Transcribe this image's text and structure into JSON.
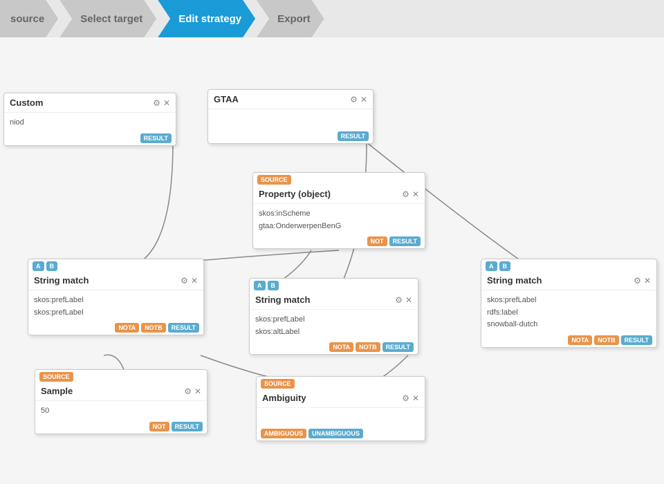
{
  "nav": {
    "steps": [
      {
        "id": "source",
        "label": "source",
        "state": "inactive"
      },
      {
        "id": "select-target",
        "label": "Select target",
        "state": "inactive"
      },
      {
        "id": "edit-strategy",
        "label": "Edit strategy",
        "state": "active"
      },
      {
        "id": "export",
        "label": "Export",
        "state": "inactive"
      }
    ]
  },
  "nodes": {
    "custom": {
      "title": "Custom",
      "prop1": "niod",
      "badges_bottom": [
        "RESULT"
      ]
    },
    "gtaa": {
      "title": "GTAA",
      "badges_bottom": [
        "RESULT"
      ]
    },
    "property_object": {
      "title": "Property (object)",
      "badge_top": "SOURCE",
      "prop1": "skos:inScheme",
      "prop2": "gtaa:OnderwerpenBenG",
      "badges_bottom": [
        "NOT",
        "RESULT"
      ]
    },
    "string_match_left": {
      "title": "String match",
      "badges_top": [
        "A",
        "B"
      ],
      "prop1": "skos:prefLabel",
      "prop2": "skos:prefLabel",
      "badges_bottom": [
        "NOTA",
        "NOTB",
        "RESULT"
      ]
    },
    "string_match_mid": {
      "title": "String match",
      "badges_top": [
        "A",
        "B"
      ],
      "prop1": "skos:prefLabel",
      "prop2": "skos:altLabel",
      "badges_bottom": [
        "NOTA",
        "NOTB",
        "RESULT"
      ]
    },
    "string_match_right": {
      "title": "String match",
      "badges_top": [
        "A",
        "B"
      ],
      "prop1": "skos:prefLabel",
      "prop2": "rdfs:label",
      "prop3": "snowball-dutch",
      "badges_bottom": [
        "NOTA",
        "NOTB",
        "RESULT"
      ]
    },
    "sample": {
      "title": "Sample",
      "badge_top": "SOURCE",
      "prop1": "50",
      "badges_bottom": [
        "NOT",
        "RESULT"
      ]
    },
    "ambiguity": {
      "title": "Ambiguity",
      "badge_top": "SOURCE",
      "badges_bottom": [
        "AMBIGUOUS",
        "UNAMBIGUOUS"
      ]
    }
  },
  "icons": {
    "gear": "⚙",
    "close": "✕"
  }
}
